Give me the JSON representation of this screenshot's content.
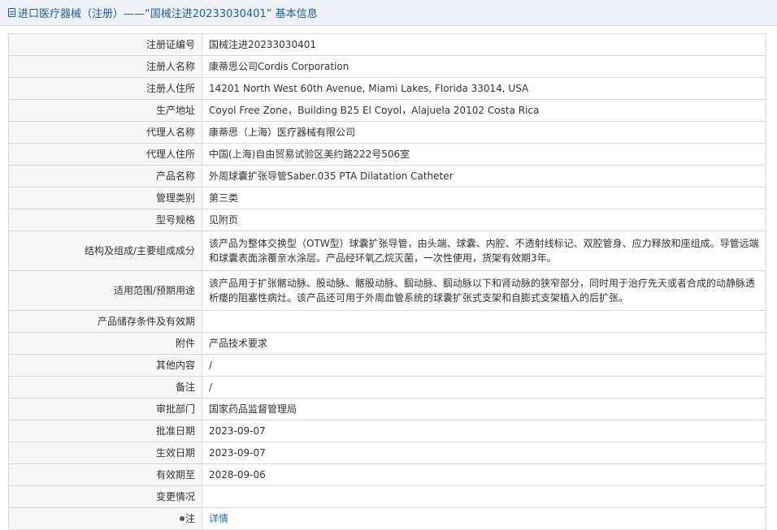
{
  "header": {
    "title": "进口医疗器械（注册）——“国械注进20233030401” 基本信息"
  },
  "rows": [
    {
      "label": "注册证编号",
      "value": "国械注进20233030401"
    },
    {
      "label": "注册人名称",
      "value": "康蒂思公司Cordis Corporation"
    },
    {
      "label": "注册人住所",
      "value": "14201 North West 60th Avenue, Miami Lakes, Florida 33014, USA"
    },
    {
      "label": "生产地址",
      "value": "Coyol Free Zone，Building B25 El Coyol，Alajuela 20102 Costa Rica"
    },
    {
      "label": "代理人名称",
      "value": "康蒂思（上海）医疗器械有限公司"
    },
    {
      "label": "代理人住所",
      "value": "中国(上海)自由贸易试验区美约路222号506室"
    },
    {
      "label": "产品名称",
      "value": "外周球囊扩张导管Saber.035 PTA Dilatation Catheter"
    },
    {
      "label": "管理类别",
      "value": "第三类"
    },
    {
      "label": "型号规格",
      "value": "见附页"
    },
    {
      "label": "结构及组成/主要组成成分",
      "value": "该产品为整体交换型（OTW型）球囊扩张导管，由头端、球囊、内腔、不透射线标记、双腔管身、应力释放和座组成。导管远端和球囊表面涂覆亲水涂层。产品经环氧乙烷灭菌，一次性使用，货架有效期3年。"
    },
    {
      "label": "适用范围/预期用途",
      "value": "该产品用于扩张髂动脉、股动脉、髂股动脉、腘动脉、腘动脉以下和肾动脉的狭窄部分，同时用于治疗先天或者合成的动静脉透析瘘的阻塞性病灶。该产品还可用于外周血管系统的球囊扩张式支架和自膨式支架植入的后扩张。"
    },
    {
      "label": "产品储存条件及有效期",
      "value": ""
    },
    {
      "label": "附件",
      "value": "产品技术要求"
    },
    {
      "label": "其他内容",
      "value": "/"
    },
    {
      "label": "备注",
      "value": "/"
    },
    {
      "label": "审批部门",
      "value": "国家药品监督管理局"
    },
    {
      "label": "批准日期",
      "value": "2023-09-07"
    },
    {
      "label": "生效日期",
      "value": "2023-09-07"
    },
    {
      "label": "有效期至",
      "value": "2028-09-06"
    },
    {
      "label": "变更情况",
      "value": ""
    }
  ],
  "note_row": {
    "label": "注",
    "icon": "bulb-icon",
    "link_text": "详情"
  }
}
